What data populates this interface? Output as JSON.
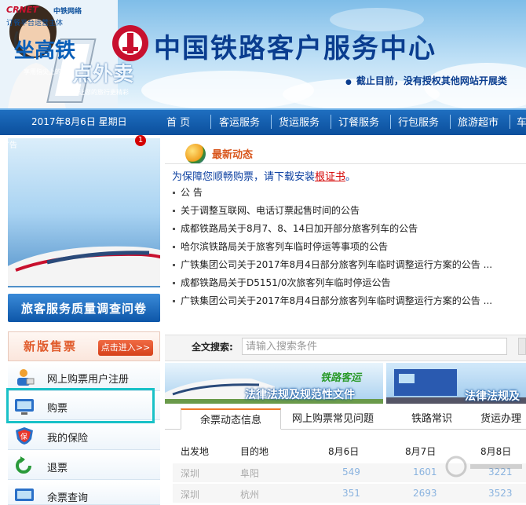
{
  "header": {
    "site_title": "中国铁路客户服务中心",
    "notice": "截止目前，没有授权其他网站开展类"
  },
  "nav": {
    "date": "2017年8月6日 星期日",
    "items": [
      "首 页",
      "客运服务",
      "货运服务",
      "订餐服务",
      "行包服务",
      "旅游超市",
      "车"
    ]
  },
  "ad": {
    "logo": "CRNET",
    "logo_cn": "中铁网络",
    "subtitle": "订餐平台运营主体",
    "headline1": "坐高铁",
    "headline1_sub": "享用指尖上的美食",
    "headline2": "点外卖",
    "headline2_sub": "让您的旅行更精彩",
    "tag": "广告",
    "slide_number": "1"
  },
  "survey": {
    "label": "旅客服务质量调查问卷"
  },
  "new_ticket": {
    "label": "新版售票",
    "button": "点击进入>>"
  },
  "menu": [
    {
      "label": "网上购票用户注册",
      "icon": "user-register-icon"
    },
    {
      "label": "购票",
      "icon": "ticket-screen-icon"
    },
    {
      "label": "我的保险",
      "icon": "insurance-shield-icon"
    },
    {
      "label": "退票",
      "icon": "refund-arrow-icon"
    },
    {
      "label": "余票查询",
      "icon": "ticket-query-icon"
    }
  ],
  "news": {
    "title": "最新动态",
    "promo_prefix": "为保障您顺畅购票，请下载安装",
    "promo_link": "根证书",
    "promo_suffix": "。",
    "items": [
      "公 告",
      "关于调整互联网、电话订票起售时间的公告",
      "成都铁路局关于8月7、8、14日加开部分旅客列车的公告",
      "哈尔滨铁路局关于旅客列车临时停运等事项的公告",
      "广铁集团公司关于2017年8月4日部分旅客列车临时调整运行方案的公告 ...",
      "成都铁路局关于D5151/0次旅客列车临时停运公告",
      "广铁集团公司关于2017年8月4日部分旅客列车临时调整运行方案的公告 ..."
    ]
  },
  "search": {
    "label": "全文搜索:",
    "placeholder": "请输入搜索条件"
  },
  "banners": {
    "left_tag": "铁路客运",
    "left_text": "法律法规及规范性文件",
    "right_text": "法律法规及"
  },
  "tabs": [
    "余票动态信息",
    "网上购票常见问题",
    "铁路常识",
    "货运办理"
  ],
  "table": {
    "headers": [
      "出发地",
      "目的地",
      "8月6日",
      "8月7日",
      "8月8日"
    ],
    "rows": [
      [
        "深圳",
        "阜阳",
        "549",
        "1601",
        "3221"
      ],
      [
        "深圳",
        "杭州",
        "351",
        "2693",
        "3523"
      ]
    ]
  },
  "colors": {
    "nav_blue": "#0b4f9c",
    "title_blue": "#0a3d8f",
    "highlight_teal": "#19c1c7",
    "news_orange": "#d8551b",
    "link_red": "#d40000"
  }
}
